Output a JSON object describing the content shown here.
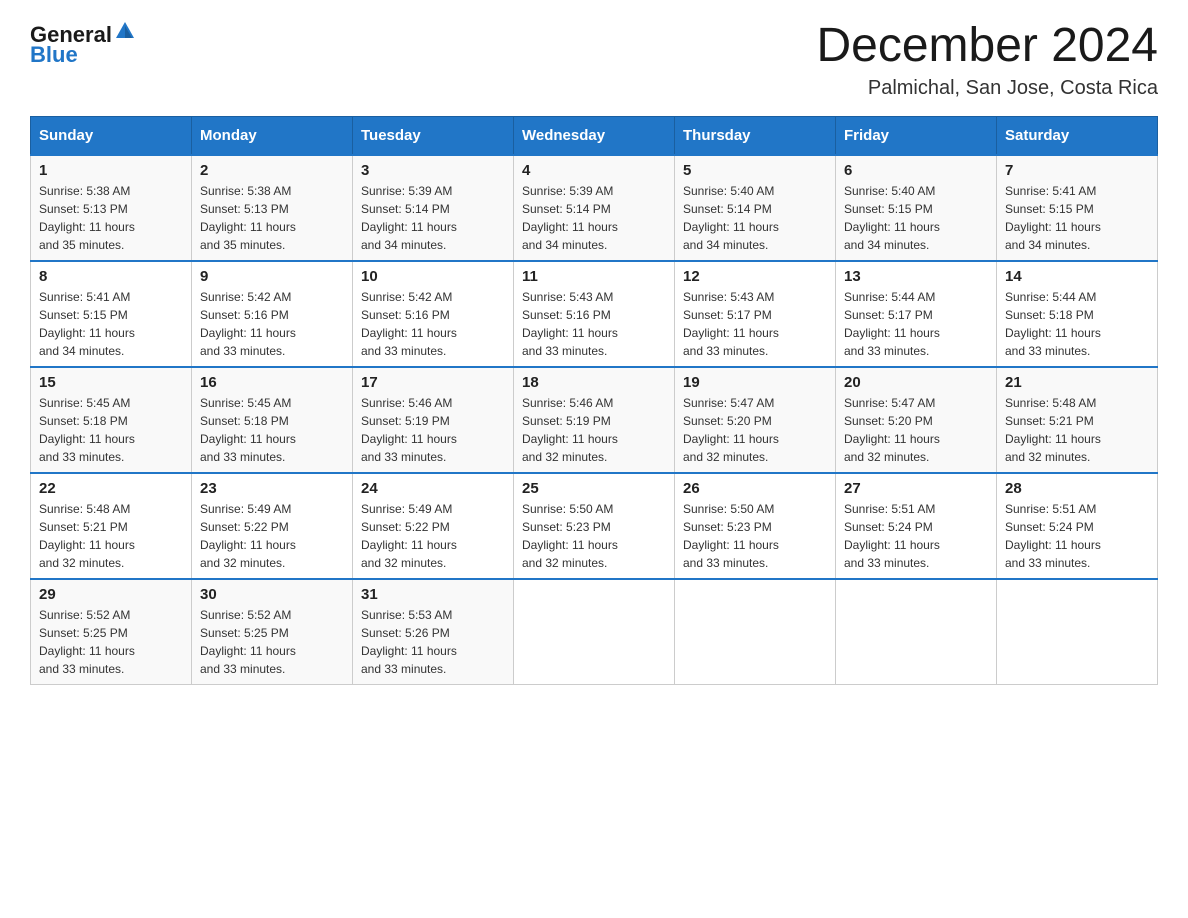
{
  "header": {
    "logo_text_general": "General",
    "logo_text_blue": "Blue",
    "month_title": "December 2024",
    "subtitle": "Palmichal, San Jose, Costa Rica"
  },
  "days_of_week": [
    "Sunday",
    "Monday",
    "Tuesday",
    "Wednesday",
    "Thursday",
    "Friday",
    "Saturday"
  ],
  "weeks": [
    [
      {
        "day": "1",
        "sunrise": "5:38 AM",
        "sunset": "5:13 PM",
        "daylight": "11 hours and 35 minutes."
      },
      {
        "day": "2",
        "sunrise": "5:38 AM",
        "sunset": "5:13 PM",
        "daylight": "11 hours and 35 minutes."
      },
      {
        "day": "3",
        "sunrise": "5:39 AM",
        "sunset": "5:14 PM",
        "daylight": "11 hours and 34 minutes."
      },
      {
        "day": "4",
        "sunrise": "5:39 AM",
        "sunset": "5:14 PM",
        "daylight": "11 hours and 34 minutes."
      },
      {
        "day": "5",
        "sunrise": "5:40 AM",
        "sunset": "5:14 PM",
        "daylight": "11 hours and 34 minutes."
      },
      {
        "day": "6",
        "sunrise": "5:40 AM",
        "sunset": "5:15 PM",
        "daylight": "11 hours and 34 minutes."
      },
      {
        "day": "7",
        "sunrise": "5:41 AM",
        "sunset": "5:15 PM",
        "daylight": "11 hours and 34 minutes."
      }
    ],
    [
      {
        "day": "8",
        "sunrise": "5:41 AM",
        "sunset": "5:15 PM",
        "daylight": "11 hours and 34 minutes."
      },
      {
        "day": "9",
        "sunrise": "5:42 AM",
        "sunset": "5:16 PM",
        "daylight": "11 hours and 33 minutes."
      },
      {
        "day": "10",
        "sunrise": "5:42 AM",
        "sunset": "5:16 PM",
        "daylight": "11 hours and 33 minutes."
      },
      {
        "day": "11",
        "sunrise": "5:43 AM",
        "sunset": "5:16 PM",
        "daylight": "11 hours and 33 minutes."
      },
      {
        "day": "12",
        "sunrise": "5:43 AM",
        "sunset": "5:17 PM",
        "daylight": "11 hours and 33 minutes."
      },
      {
        "day": "13",
        "sunrise": "5:44 AM",
        "sunset": "5:17 PM",
        "daylight": "11 hours and 33 minutes."
      },
      {
        "day": "14",
        "sunrise": "5:44 AM",
        "sunset": "5:18 PM",
        "daylight": "11 hours and 33 minutes."
      }
    ],
    [
      {
        "day": "15",
        "sunrise": "5:45 AM",
        "sunset": "5:18 PM",
        "daylight": "11 hours and 33 minutes."
      },
      {
        "day": "16",
        "sunrise": "5:45 AM",
        "sunset": "5:18 PM",
        "daylight": "11 hours and 33 minutes."
      },
      {
        "day": "17",
        "sunrise": "5:46 AM",
        "sunset": "5:19 PM",
        "daylight": "11 hours and 33 minutes."
      },
      {
        "day": "18",
        "sunrise": "5:46 AM",
        "sunset": "5:19 PM",
        "daylight": "11 hours and 32 minutes."
      },
      {
        "day": "19",
        "sunrise": "5:47 AM",
        "sunset": "5:20 PM",
        "daylight": "11 hours and 32 minutes."
      },
      {
        "day": "20",
        "sunrise": "5:47 AM",
        "sunset": "5:20 PM",
        "daylight": "11 hours and 32 minutes."
      },
      {
        "day": "21",
        "sunrise": "5:48 AM",
        "sunset": "5:21 PM",
        "daylight": "11 hours and 32 minutes."
      }
    ],
    [
      {
        "day": "22",
        "sunrise": "5:48 AM",
        "sunset": "5:21 PM",
        "daylight": "11 hours and 32 minutes."
      },
      {
        "day": "23",
        "sunrise": "5:49 AM",
        "sunset": "5:22 PM",
        "daylight": "11 hours and 32 minutes."
      },
      {
        "day": "24",
        "sunrise": "5:49 AM",
        "sunset": "5:22 PM",
        "daylight": "11 hours and 32 minutes."
      },
      {
        "day": "25",
        "sunrise": "5:50 AM",
        "sunset": "5:23 PM",
        "daylight": "11 hours and 32 minutes."
      },
      {
        "day": "26",
        "sunrise": "5:50 AM",
        "sunset": "5:23 PM",
        "daylight": "11 hours and 33 minutes."
      },
      {
        "day": "27",
        "sunrise": "5:51 AM",
        "sunset": "5:24 PM",
        "daylight": "11 hours and 33 minutes."
      },
      {
        "day": "28",
        "sunrise": "5:51 AM",
        "sunset": "5:24 PM",
        "daylight": "11 hours and 33 minutes."
      }
    ],
    [
      {
        "day": "29",
        "sunrise": "5:52 AM",
        "sunset": "5:25 PM",
        "daylight": "11 hours and 33 minutes."
      },
      {
        "day": "30",
        "sunrise": "5:52 AM",
        "sunset": "5:25 PM",
        "daylight": "11 hours and 33 minutes."
      },
      {
        "day": "31",
        "sunrise": "5:53 AM",
        "sunset": "5:26 PM",
        "daylight": "11 hours and 33 minutes."
      },
      null,
      null,
      null,
      null
    ]
  ],
  "labels": {
    "sunrise": "Sunrise:",
    "sunset": "Sunset:",
    "daylight": "Daylight:"
  }
}
